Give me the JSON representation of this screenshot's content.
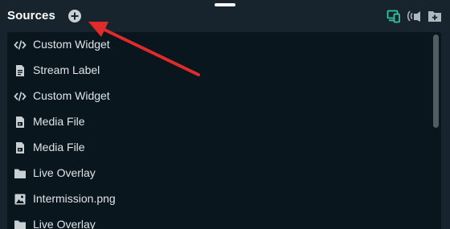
{
  "header": {
    "title": "Sources"
  },
  "icons": {
    "add": "plus-circle-icon",
    "device": "devices-icon",
    "broadcast": "broadcast-icon",
    "folder_add": "folder-add-icon"
  },
  "colors": {
    "accent": "#31c3a2",
    "panel": "#17242d",
    "list_bg": "#09161d",
    "annotation": "#e02b2b"
  },
  "sources": [
    {
      "label": "Custom Widget",
      "icon": "code-icon"
    },
    {
      "label": "Stream Label",
      "icon": "document-icon"
    },
    {
      "label": "Custom Widget",
      "icon": "code-icon"
    },
    {
      "label": "Media File",
      "icon": "media-file-icon"
    },
    {
      "label": "Media File",
      "icon": "media-file-icon"
    },
    {
      "label": "Live Overlay",
      "icon": "folder-icon"
    },
    {
      "label": "Intermission.png",
      "icon": "image-icon"
    },
    {
      "label": "Live Overlay",
      "icon": "folder-icon"
    }
  ]
}
